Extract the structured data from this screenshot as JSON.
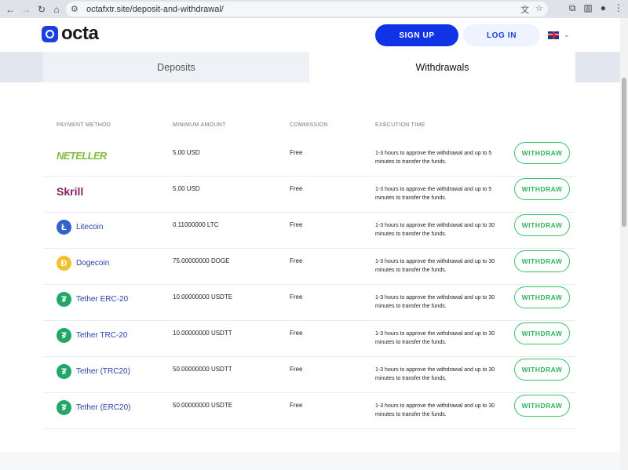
{
  "browser": {
    "url": "octafxtr.site/deposit-and-withdrawal/"
  },
  "header": {
    "logo_text": "octa",
    "signup_label": "SIGN UP",
    "login_label": "LOG IN",
    "language_icon": "uk-flag-icon"
  },
  "tabs": [
    {
      "label": "Deposits",
      "active": false
    },
    {
      "label": "Withdrawals",
      "active": true
    }
  ],
  "table": {
    "headers": [
      "PAYMENT METHOD",
      "MINIMUM AMOUNT",
      "COMMISSION",
      "EXECUTION TIME"
    ],
    "rows": [
      {
        "method": "NETELLER",
        "amount": "5.00 USD",
        "commission": "Free",
        "time": "1-3 hours to approve the withdrawal and up to 5 minutes to transfer the funds.",
        "action": "WITHDRAW"
      },
      {
        "method": "Skrill",
        "amount": "5.00 USD",
        "commission": "Free",
        "time": "1-3 hours to approve the withdrawal and up to 5 minutes to transfer the funds.",
        "action": "WITHDRAW"
      },
      {
        "method": "Litecoin",
        "amount": "0.11000000 LTC",
        "commission": "Free",
        "time": "1-3 hours to approve the withdrawal and up to 30 minutes to transfer the funds.",
        "action": "WITHDRAW"
      },
      {
        "method": "Dogecoin",
        "amount": "75.00000000 DOGE",
        "commission": "Free",
        "time": "1-3 hours to approve the withdrawal and up to 30 minutes to transfer the funds.",
        "action": "WITHDRAW"
      },
      {
        "method": "Tether ERC-20",
        "amount": "10.00000000 USDTE",
        "commission": "Free",
        "time": "1-3 hours to approve the withdrawal and up to 30 minutes to transfer the funds.",
        "action": "WITHDRAW"
      },
      {
        "method": "Tether TRC-20",
        "amount": "10.00000000 USDTT",
        "commission": "Free",
        "time": "1-3 hours to approve the withdrawal and up to 30 minutes to transfer the funds.",
        "action": "WITHDRAW"
      },
      {
        "method": "Tether (TRC20)",
        "amount": "50.00000000 USDTT",
        "commission": "Free",
        "time": "1-3 hours to approve the withdrawal and up to 30 minutes to transfer the funds.",
        "action": "WITHDRAW"
      },
      {
        "method": "Tether (ERC20)",
        "amount": "50.00000000 USDTE",
        "commission": "Free",
        "time": "1-3 hours to approve the withdrawal and up to 30 minutes to transfer the funds.",
        "action": "WITHDRAW"
      }
    ]
  }
}
